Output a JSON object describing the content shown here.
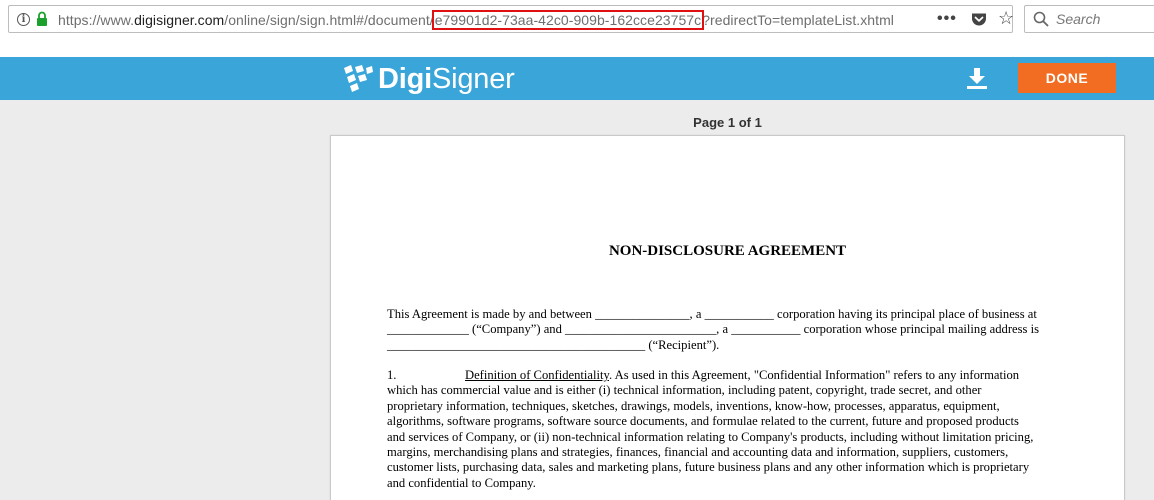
{
  "browser": {
    "url_prefix": "https://www.",
    "url_host": "digisigner.com",
    "url_path": "/online/sign/sign.html#/document/",
    "url_highlight": "e79901d2-73aa-42c0-909b-162cce23757c",
    "url_suffix": "?redirectTo=templateList.xhtml",
    "menu_label": "•••",
    "search_placeholder": "Search"
  },
  "app": {
    "logo_bold": "Digi",
    "logo_light": "Signer",
    "done_label": "DONE",
    "brand_color": "#3aa5d8",
    "accent_color": "#f26c21"
  },
  "viewer": {
    "page_indicator": "Page 1 of 1"
  },
  "document": {
    "title": "NON-DISCLOSURE AGREEMENT",
    "para1": [
      "This Agreement is made by and between _______________, a ___________ corporation having its principal place of business at",
      "_____________ (“Company”) and ________________________, a ___________ corporation whose principal mailing address is",
      "_________________________________________ (“Recipient”)."
    ],
    "para2_number": "1.",
    "para2_heading": "Definition of Confidentiality",
    "para2_first": ". As used in this Agreement, \"Confidential Information\" refers to any information",
    "para2_lines": [
      "which has commercial value and is either (i) technical information, including patent, copyright, trade secret, and other",
      "proprietary information, techniques, sketches, drawings, models, inventions, know-how, processes, apparatus, equipment,",
      "algorithms, software programs, software source documents, and formulae related to the current, future and proposed products",
      "and services of Company, or (ii) non-technical information relating to Company's products, including without limitation pricing,",
      "margins, merchandising plans and strategies, finances, financial and accounting data and information, suppliers, customers,",
      "customer lists, purchasing data, sales and marketing plans, future business plans and any other information which is proprietary",
      "and confidential to Company."
    ]
  }
}
